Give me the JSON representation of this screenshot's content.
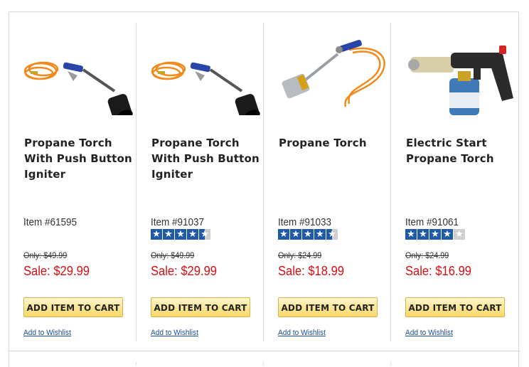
{
  "products": [
    {
      "title": "Propane Torch With Push Button Igniter",
      "item": "Item #61595",
      "rating": null,
      "only": "Only: $49.99",
      "sale": "Sale: $29.99",
      "cart_label": "ADD ITEM TO CART",
      "wishlist_label": "Add to Wishlist",
      "image_icon": "propane-torch-orange-hose-icon"
    },
    {
      "title": "Propane Torch With Push Button Igniter",
      "item": "Item #91037",
      "rating": 4.5,
      "only": "Only: $49.99",
      "sale": "Sale: $29.99",
      "cart_label": "ADD ITEM TO CART",
      "wishlist_label": "Add to Wishlist",
      "image_icon": "propane-torch-orange-hose-icon"
    },
    {
      "title": "Propane Torch",
      "item": "Item #91033",
      "rating": 4.5,
      "only": "Only: $24.99",
      "sale": "Sale: $18.99",
      "cart_label": "ADD ITEM TO CART",
      "wishlist_label": "Add to Wishlist",
      "image_icon": "propane-torch-silver-nozzle-icon"
    },
    {
      "title": "Electric Start Propane Torch",
      "item": "Item #91061",
      "rating": 4,
      "only": "Only: $24.99",
      "sale": "Sale: $16.99",
      "cart_label": "ADD ITEM TO CART",
      "wishlist_label": "Add to Wishlist",
      "image_icon": "electric-start-torch-with-cylinder-icon"
    }
  ],
  "colors": {
    "sale_red": "#d40f14",
    "star_blue": "#1f5aa8",
    "button_gold": "#f7d765",
    "link_blue": "#1a4fa0"
  }
}
